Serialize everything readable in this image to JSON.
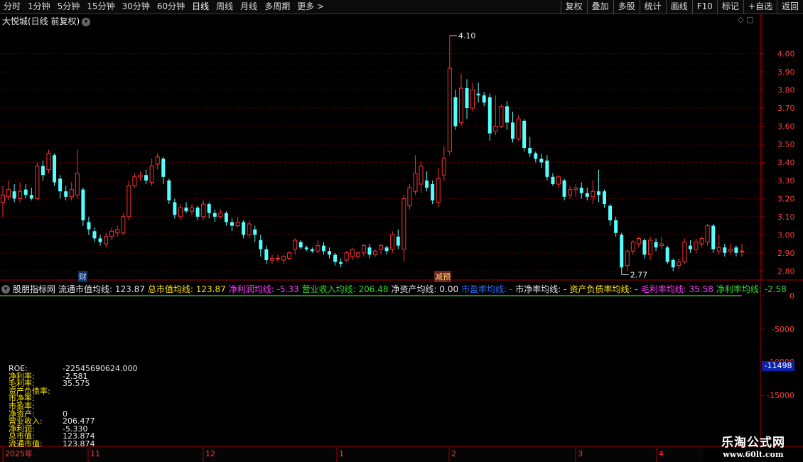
{
  "toolbar": {
    "periods": [
      "分时",
      "1分钟",
      "5分钟",
      "15分钟",
      "30分钟",
      "60分钟",
      "日线",
      "周线",
      "月线",
      "多周期",
      "更多 >"
    ],
    "active_period": "日线",
    "actions": [
      "复权",
      "叠加",
      "多股",
      "统计",
      "画线",
      "F10",
      "标记",
      "+自选",
      "返回"
    ]
  },
  "chart_title": "大悦城(日线 前复权)",
  "price_axis": {
    "ticks": [
      "4.00",
      "3.90",
      "3.80",
      "3.70",
      "3.60",
      "3.50",
      "3.40",
      "3.30",
      "3.20",
      "3.10",
      "3.00",
      "2.90",
      "2.80"
    ],
    "high_label": "4.10",
    "low_label": "2.77"
  },
  "events": {
    "cai": "财",
    "jian": "减预"
  },
  "indicator": {
    "name": "股朋指标网",
    "items": [
      {
        "label": "流通市值均线: 123.87",
        "color": "#e8e8e8"
      },
      {
        "label": "总市值均线: 123.87",
        "color": "#ffe600"
      },
      {
        "label": "净利润均线: -5.33",
        "color": "#ff3cff"
      },
      {
        "label": "营业收入均线: 206.48",
        "color": "#31d831"
      },
      {
        "label": "净资产均线: 0.00",
        "color": "#e8e8e8"
      },
      {
        "label": "市盈率均线: -",
        "color": "#2f6bff"
      },
      {
        "label": "市净率均线: -",
        "color": "#e8e8e8"
      },
      {
        "label": "资产负债率均线: -",
        "color": "#ffe600"
      },
      {
        "label": "毛利率均线: 35.58",
        "color": "#ff3cff"
      },
      {
        "label": "净利率均线: -2.58",
        "color": "#31d831"
      }
    ],
    "axis_ticks": [
      "0",
      "-5000",
      "-10000",
      "-15000"
    ],
    "current_value": "-11498"
  },
  "roe_panel": [
    {
      "k": "ROE:",
      "v": "-22545690624.000",
      "color": "#e8e8e8"
    },
    {
      "k": "净利率:",
      "v": "-2.581",
      "color": "#ffe600"
    },
    {
      "k": "毛利率:",
      "v": "35.575",
      "color": "#ffe600"
    },
    {
      "k": "资产负债率:",
      "v": "",
      "color": "#ffe600"
    },
    {
      "k": "市净率:",
      "v": "",
      "color": "#ffe600"
    },
    {
      "k": "市盈率:",
      "v": "",
      "color": "#ffe600"
    },
    {
      "k": "净资产:",
      "v": "0",
      "color": "#ffe600"
    },
    {
      "k": "营业收入:",
      "v": "206.477",
      "color": "#ffe600"
    },
    {
      "k": "净利润:",
      "v": "-5.330",
      "color": "#ffe600"
    },
    {
      "k": "总市值:",
      "v": "123.874",
      "color": "#ffe600"
    },
    {
      "k": "流通市值:",
      "v": "123.874",
      "color": "#ffe600"
    }
  ],
  "date_axis": [
    "2025年",
    "11",
    "12",
    "1",
    "2",
    "3",
    "4"
  ],
  "watermark": {
    "line1": "乐淘公式网",
    "line2": "www.60lt.com"
  },
  "colors": {
    "up": "#ff3232",
    "down": "#54ffff",
    "grid": "#7a0000"
  },
  "chart_data": {
    "type": "candlestick",
    "ylim": [
      2.75,
      4.14
    ],
    "candles": [
      [
        3.18,
        3.22,
        3.1,
        3.27
      ],
      [
        3.21,
        3.25,
        3.19,
        3.3
      ],
      [
        3.24,
        3.2,
        3.18,
        3.28
      ],
      [
        3.2,
        3.24,
        3.18,
        3.29
      ],
      [
        3.25,
        3.22,
        3.2,
        3.28
      ],
      [
        3.22,
        3.2,
        3.19,
        3.26
      ],
      [
        3.2,
        3.38,
        3.19,
        3.4
      ],
      [
        3.38,
        3.33,
        3.3,
        3.41
      ],
      [
        3.36,
        3.45,
        3.34,
        3.47
      ],
      [
        3.44,
        3.29,
        3.27,
        3.45
      ],
      [
        3.31,
        3.24,
        3.2,
        3.33
      ],
      [
        3.24,
        3.21,
        3.19,
        3.27
      ],
      [
        3.21,
        3.25,
        3.19,
        3.29
      ],
      [
        3.22,
        3.34,
        3.2,
        3.47
      ],
      [
        3.25,
        3.08,
        3.05,
        3.26
      ],
      [
        3.07,
        3.03,
        3.0,
        3.1
      ],
      [
        3.02,
        2.98,
        2.96,
        3.04
      ],
      [
        2.98,
        2.96,
        2.94,
        3.0
      ],
      [
        2.95,
        2.99,
        2.93,
        3.01
      ],
      [
        2.99,
        3.02,
        2.97,
        3.04
      ],
      [
        3.01,
        3.03,
        2.99,
        3.05
      ],
      [
        3.01,
        3.1,
        3.0,
        3.12
      ],
      [
        3.1,
        3.27,
        3.08,
        3.3
      ],
      [
        3.27,
        3.32,
        3.26,
        3.34
      ],
      [
        3.32,
        3.33,
        3.3,
        3.35
      ],
      [
        3.33,
        3.3,
        3.28,
        3.36
      ],
      [
        3.29,
        3.38,
        3.27,
        3.42
      ],
      [
        3.39,
        3.43,
        3.36,
        3.45
      ],
      [
        3.42,
        3.32,
        3.28,
        3.43
      ],
      [
        3.3,
        3.19,
        3.17,
        3.31
      ],
      [
        3.18,
        3.11,
        3.09,
        3.2
      ],
      [
        3.1,
        3.15,
        3.08,
        3.17
      ],
      [
        3.15,
        3.13,
        3.12,
        3.18
      ],
      [
        3.13,
        3.15,
        3.11,
        3.17
      ],
      [
        3.15,
        3.1,
        3.08,
        3.16
      ],
      [
        3.1,
        3.17,
        3.08,
        3.19
      ],
      [
        3.17,
        3.12,
        3.09,
        3.18
      ],
      [
        3.12,
        3.1,
        3.07,
        3.14
      ],
      [
        3.1,
        3.12,
        3.09,
        3.14
      ],
      [
        3.12,
        3.07,
        3.05,
        3.13
      ],
      [
        3.07,
        3.05,
        3.02,
        3.09
      ],
      [
        3.05,
        3.07,
        3.04,
        3.1
      ],
      [
        3.07,
        3.0,
        2.98,
        3.08
      ],
      [
        3.0,
        3.06,
        2.98,
        3.08
      ],
      [
        3.03,
        3.0,
        2.96,
        3.05
      ],
      [
        2.97,
        2.92,
        2.88,
        3.0
      ],
      [
        2.92,
        2.86,
        2.84,
        2.94
      ],
      [
        2.86,
        2.87,
        2.84,
        2.89
      ],
      [
        2.87,
        2.87,
        2.85,
        2.89
      ],
      [
        2.86,
        2.88,
        2.84,
        2.89
      ],
      [
        2.87,
        2.9,
        2.86,
        2.91
      ],
      [
        2.92,
        2.97,
        2.89,
        2.98
      ],
      [
        2.96,
        2.93,
        2.92,
        2.97
      ],
      [
        2.93,
        2.92,
        2.91,
        2.94
      ],
      [
        2.92,
        2.91,
        2.9,
        2.93
      ],
      [
        2.91,
        2.94,
        2.9,
        2.97
      ],
      [
        2.94,
        2.91,
        2.89,
        2.96
      ],
      [
        2.91,
        2.89,
        2.87,
        2.93
      ],
      [
        2.89,
        2.85,
        2.83,
        2.9
      ],
      [
        2.85,
        2.84,
        2.82,
        2.87
      ],
      [
        2.86,
        2.9,
        2.85,
        2.91
      ],
      [
        2.88,
        2.92,
        2.86,
        2.93
      ],
      [
        2.88,
        2.9,
        2.87,
        2.91
      ],
      [
        2.9,
        2.94,
        2.88,
        2.95
      ],
      [
        2.93,
        2.89,
        2.87,
        2.95
      ],
      [
        2.89,
        2.91,
        2.88,
        2.92
      ],
      [
        2.92,
        2.94,
        2.89,
        2.95
      ],
      [
        2.93,
        2.91,
        2.89,
        2.94
      ],
      [
        2.92,
        3.0,
        2.9,
        3.02
      ],
      [
        2.99,
        2.94,
        2.92,
        3.03
      ],
      [
        2.92,
        3.2,
        2.85,
        3.22
      ],
      [
        3.16,
        3.26,
        3.14,
        3.28
      ],
      [
        3.24,
        3.34,
        3.22,
        3.44
      ],
      [
        3.28,
        3.38,
        3.23,
        3.41
      ],
      [
        3.3,
        3.26,
        3.24,
        3.35
      ],
      [
        3.28,
        3.19,
        3.17,
        3.3
      ],
      [
        3.18,
        3.31,
        3.15,
        3.37
      ],
      [
        3.33,
        3.42,
        3.3,
        3.49
      ],
      [
        3.46,
        3.92,
        3.44,
        4.1
      ],
      [
        3.76,
        3.6,
        3.58,
        3.8
      ],
      [
        3.62,
        3.81,
        3.6,
        3.89
      ],
      [
        3.81,
        3.7,
        3.64,
        3.86
      ],
      [
        3.7,
        3.8,
        3.68,
        3.84
      ],
      [
        3.78,
        3.77,
        3.73,
        3.84
      ],
      [
        3.77,
        3.73,
        3.71,
        3.79
      ],
      [
        3.76,
        3.56,
        3.52,
        3.78
      ],
      [
        3.57,
        3.6,
        3.55,
        3.77
      ],
      [
        3.6,
        3.71,
        3.59,
        3.72
      ],
      [
        3.71,
        3.62,
        3.58,
        3.74
      ],
      [
        3.62,
        3.53,
        3.51,
        3.68
      ],
      [
        3.53,
        3.64,
        3.52,
        3.66
      ],
      [
        3.63,
        3.48,
        3.46,
        3.64
      ],
      [
        3.48,
        3.45,
        3.43,
        3.54
      ],
      [
        3.45,
        3.42,
        3.4,
        3.46
      ],
      [
        3.42,
        3.4,
        3.37,
        3.45
      ],
      [
        3.41,
        3.32,
        3.3,
        3.44
      ],
      [
        3.32,
        3.28,
        3.27,
        3.34
      ],
      [
        3.28,
        3.32,
        3.26,
        3.33
      ],
      [
        3.3,
        3.21,
        3.19,
        3.31
      ],
      [
        3.22,
        3.25,
        3.2,
        3.27
      ],
      [
        3.25,
        3.26,
        3.21,
        3.28
      ],
      [
        3.26,
        3.23,
        3.2,
        3.29
      ],
      [
        3.23,
        3.21,
        3.19,
        3.26
      ],
      [
        3.21,
        3.24,
        3.17,
        3.3
      ],
      [
        3.24,
        3.22,
        3.18,
        3.36
      ],
      [
        3.24,
        3.17,
        3.15,
        3.25
      ],
      [
        3.16,
        3.08,
        3.05,
        3.17
      ],
      [
        3.08,
        3.01,
        2.99,
        3.1
      ],
      [
        3.0,
        2.82,
        2.78,
        3.01
      ],
      [
        2.83,
        2.91,
        2.8,
        2.92
      ],
      [
        2.91,
        2.96,
        2.89,
        2.97
      ],
      [
        2.95,
        2.98,
        2.93,
        2.99
      ],
      [
        2.97,
        2.89,
        2.87,
        2.98
      ],
      [
        2.89,
        2.97,
        2.86,
        2.99
      ],
      [
        2.96,
        2.93,
        2.91,
        2.98
      ],
      [
        2.94,
        2.95,
        2.92,
        2.99
      ],
      [
        2.93,
        2.85,
        2.84,
        2.94
      ],
      [
        2.86,
        2.82,
        2.8,
        2.87
      ],
      [
        2.83,
        2.85,
        2.81,
        2.87
      ],
      [
        2.85,
        2.96,
        2.84,
        2.98
      ],
      [
        2.94,
        2.92,
        2.9,
        2.97
      ],
      [
        2.92,
        2.96,
        2.9,
        2.98
      ],
      [
        2.95,
        2.98,
        2.93,
        2.99
      ],
      [
        2.96,
        3.05,
        2.94,
        3.06
      ],
      [
        3.05,
        2.92,
        2.9,
        3.06
      ],
      [
        2.91,
        2.93,
        2.89,
        3.0
      ],
      [
        2.93,
        2.9,
        2.88,
        2.95
      ],
      [
        2.91,
        2.92,
        2.89,
        2.95
      ],
      [
        2.93,
        2.9,
        2.88,
        2.94
      ],
      [
        2.91,
        2.91,
        2.88,
        2.95
      ]
    ]
  }
}
